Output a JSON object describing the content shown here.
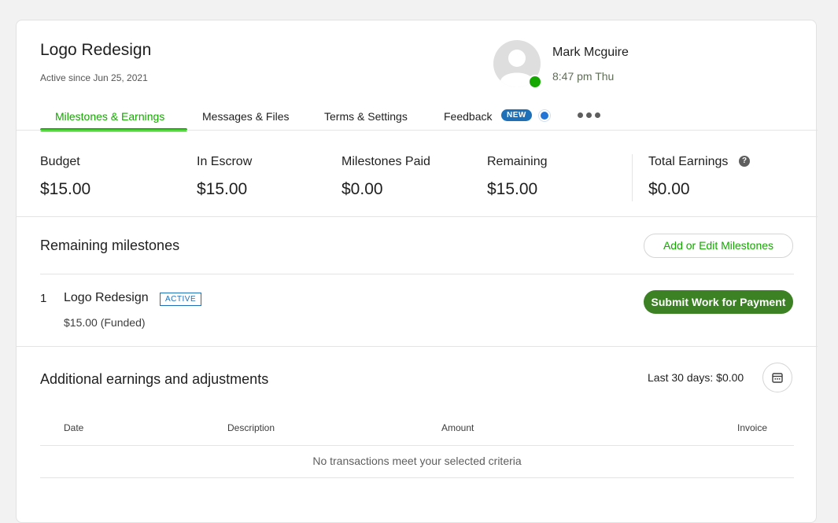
{
  "contract": {
    "title": "Logo Redesign",
    "subtitle": "Active since Jun 25, 2021"
  },
  "user": {
    "name": "Mark Mcguire",
    "time": "8:47 pm Thu",
    "status_color": "#14a800"
  },
  "tabs": [
    {
      "label": "Milestones & Earnings",
      "active": true
    },
    {
      "label": "Messages & Files"
    },
    {
      "label": "Terms & Settings"
    },
    {
      "label": "Feedback",
      "badge": "NEW"
    }
  ],
  "stats": [
    {
      "label": "Budget",
      "value": "$15.00"
    },
    {
      "label": "In Escrow",
      "value": "$15.00"
    },
    {
      "label": "Milestones Paid",
      "value": "$0.00"
    },
    {
      "label": "Remaining",
      "value": "$15.00"
    },
    {
      "label": "Total Earnings",
      "value": "$0.00"
    }
  ],
  "remaining": {
    "title": "Remaining milestones",
    "add_button": "Add or Edit Milestones",
    "milestones": [
      {
        "number": "1",
        "name": "Logo Redesign",
        "status": "ACTIVE",
        "amount": "$15.00 (Funded)",
        "action": "Submit Work for Payment"
      }
    ]
  },
  "additional": {
    "title": "Additional earnings and adjustments",
    "summary": "Last 30 days: $0.00",
    "columns": [
      "Date",
      "Description",
      "Amount",
      "Invoice"
    ],
    "empty_text": "No transactions meet your selected criteria"
  },
  "colors": {
    "accent": "#14a800",
    "primary_button": "#3c8224",
    "badge_blue": "#1d6fb8"
  }
}
